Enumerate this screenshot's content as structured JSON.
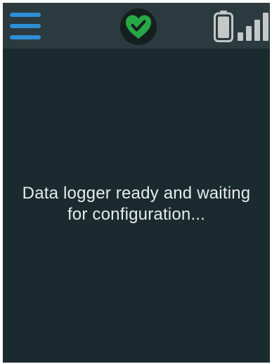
{
  "colors": {
    "screen_background": "#1b2a2e",
    "status_bar_background": "#2b3a3e",
    "menu_accent": "#2e8fd6",
    "health_ok": "#27a847",
    "icon_gray": "#c4c8c8",
    "text": "#e6ecec"
  },
  "status_bar": {
    "menu_icon": "hamburger-menu-icon",
    "health_icon": "heart-check-icon",
    "battery_icon": "battery-icon",
    "signal_icon": "signal-strength-icon",
    "signal_bars_active": 4,
    "signal_bars_total": 4
  },
  "main": {
    "message": "Data logger ready and waiting for configuration..."
  }
}
